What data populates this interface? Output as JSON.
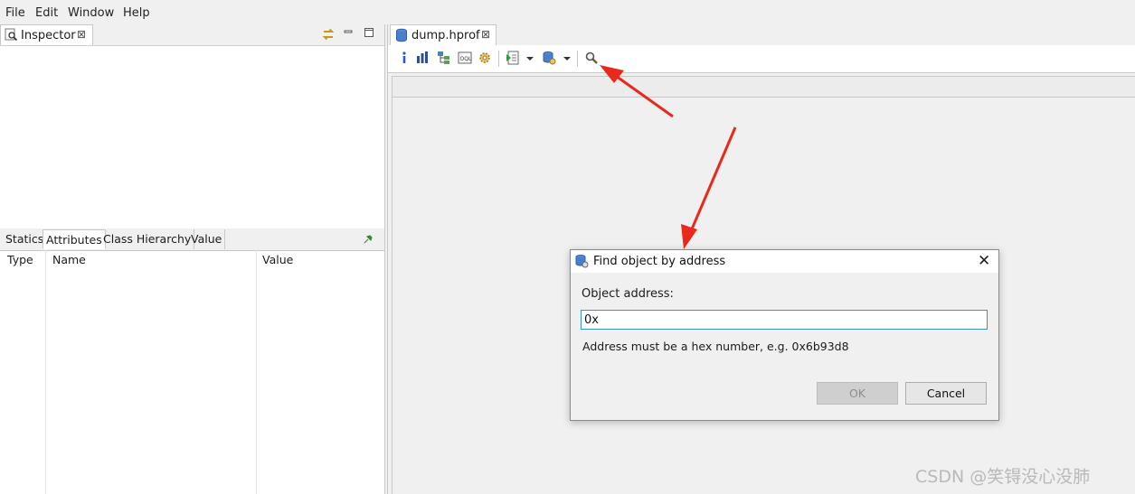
{
  "menubar": {
    "items": [
      "File",
      "Edit",
      "Window",
      "Help"
    ]
  },
  "inspector": {
    "tab_label": "Inspector",
    "close_glyph": "⊠",
    "subtabs": [
      "Statics",
      "Attributes",
      "Class Hierarchy",
      "Value"
    ],
    "active_subtab": "Attributes",
    "columns": [
      "Type",
      "Name",
      "Value"
    ],
    "icons": [
      "inspector-icon",
      "sync-icon",
      "minimize-icon",
      "maximize-icon",
      "pin-icon"
    ]
  },
  "editor": {
    "tab_label": "dump.hprof",
    "close_glyph": "⊠",
    "toolbar_icons": [
      "info-icon",
      "histogram-icon",
      "dominator-tree-icon",
      "oql-icon",
      "heap-dump-overview-icon",
      "run-report-icon",
      "report-dropdown-icon",
      "query-browser-icon",
      "query-dropdown-icon",
      "find-object-by-address-icon"
    ]
  },
  "dialog": {
    "title": "Find object by address",
    "close_glyph": "✕",
    "label": "Object address:",
    "input_value": "0x",
    "hint": "Address must be a hex number, e.g. 0x6b93d8",
    "ok_label": "OK",
    "cancel_label": "Cancel"
  },
  "annotations": {
    "arrow_color": "#e8291c"
  },
  "watermark": "CSDN @笑锝没心没肺"
}
